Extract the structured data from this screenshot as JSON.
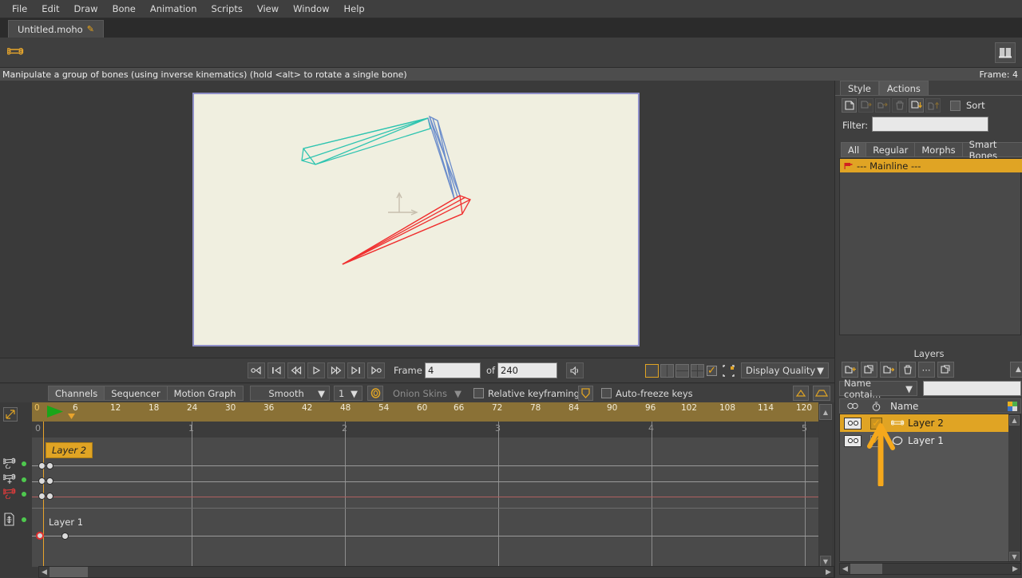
{
  "app": {
    "title": "Moho"
  },
  "menubar": {
    "items": [
      {
        "label": "File"
      },
      {
        "label": "Edit"
      },
      {
        "label": "Draw"
      },
      {
        "label": "Bone"
      },
      {
        "label": "Animation"
      },
      {
        "label": "Scripts"
      },
      {
        "label": "View"
      },
      {
        "label": "Window"
      },
      {
        "label": "Help"
      }
    ]
  },
  "tabbar": {
    "document_tab": "Untitled.moho",
    "modified_marker": "pencil-icon"
  },
  "toolbar": {
    "tool_icon": "bone-manipulate-icon",
    "right_icon": "book-panel-icon"
  },
  "statusbar": {
    "hint": "Manipulate a group of bones (using inverse kinematics) (hold <alt> to rotate a single bone)",
    "frame_label": "Frame: 4"
  },
  "canvas": {
    "background": "#f0efe0",
    "border_color": "#8f8fc8",
    "bones": [
      {
        "name": "upper-bone-teal",
        "color": "#2ec4b0"
      },
      {
        "name": "mid-bone-blue",
        "color": "#6a8ccb"
      },
      {
        "name": "lower-bone-red",
        "color": "#f03030"
      }
    ],
    "origin_gizmo": "move-axis-gizmo"
  },
  "playback": {
    "buttons": [
      {
        "name": "jump-to-start-button",
        "glyph": "o◁"
      },
      {
        "name": "previous-keyframe-button",
        "glyph": "|◁"
      },
      {
        "name": "step-back-button",
        "glyph": "◁◁"
      },
      {
        "name": "play-button",
        "glyph": "▷"
      },
      {
        "name": "step-forward-button",
        "glyph": "▷▷"
      },
      {
        "name": "next-keyframe-button",
        "glyph": "▷|"
      },
      {
        "name": "jump-to-end-button",
        "glyph": "▷o"
      }
    ],
    "frame_label": "Frame",
    "frame_value": "4",
    "of_label": "of",
    "total_frames": "240",
    "audio_button": "speaker-icon",
    "view_buttons": [
      {
        "name": "single-view-button",
        "selected": true
      },
      {
        "name": "split-vertical-view-button",
        "selected": false
      },
      {
        "name": "split-horizontal-view-button",
        "selected": false
      },
      {
        "name": "quad-view-button",
        "selected": false
      }
    ],
    "enable_checkbox": {
      "label": "",
      "checked": true
    },
    "select_tool": "select-bounds-icon",
    "display_quality": "Display Quality"
  },
  "timeline_toolbar": {
    "mode_tabs": [
      {
        "label": "Channels",
        "active": true
      },
      {
        "label": "Sequencer",
        "active": false
      },
      {
        "label": "Motion Graph",
        "active": false
      }
    ],
    "interpolation": "Smooth",
    "interp_value": "1",
    "onion_icon": "onion-skin-toggle-icon",
    "onion_skins": "Onion Skins",
    "relative_keyframing": {
      "label": "Relative keyframing",
      "checked": false
    },
    "shield_icon": "shield-icon",
    "auto_freeze_keys": {
      "label": "Auto-freeze keys",
      "checked": false
    },
    "right_buttons": [
      {
        "name": "ease-in-button"
      },
      {
        "name": "ease-both-button"
      }
    ]
  },
  "timeline": {
    "ruler_ticks": [
      "0",
      "6",
      "12",
      "18",
      "24",
      "30",
      "36",
      "42",
      "48",
      "54",
      "60",
      "66",
      "72",
      "78",
      "84",
      "90",
      "96",
      "102",
      "108",
      "114",
      "120"
    ],
    "second_labels": [
      "0",
      "1",
      "2",
      "3",
      "4",
      "5"
    ],
    "playhead_frame": "4",
    "channels": [
      {
        "name": "bone-rotate-channel",
        "icon": "bone-rotate-icon",
        "enabled": true
      },
      {
        "name": "bone-translate-channel",
        "icon": "bone-translate-icon",
        "enabled": true
      },
      {
        "name": "bone-scale-channel",
        "icon": "bone-scale-icon",
        "enabled": true,
        "highlight": true
      },
      {
        "name": "layer-transform-channel",
        "icon": "layer-transform-icon",
        "enabled": true
      }
    ],
    "group_labels": [
      {
        "text": "Layer 2",
        "style": "chip"
      },
      {
        "text": "Layer 1",
        "style": "plain"
      }
    ],
    "expand_icon": "expand-timeline-icon"
  },
  "actions_panel": {
    "tabs": [
      {
        "label": "Style",
        "active": false
      },
      {
        "label": "Actions",
        "active": true
      }
    ],
    "toolbar_buttons": [
      {
        "name": "new-action-button",
        "enabled": true
      },
      {
        "name": "duplicate-action-button",
        "enabled": false
      },
      {
        "name": "rename-action-button",
        "enabled": false
      },
      {
        "name": "delete-action-button",
        "enabled": false
      },
      {
        "name": "insert-action-button",
        "enabled": true
      },
      {
        "name": "extract-action-button",
        "enabled": false
      }
    ],
    "sort_label": "Sort",
    "sort_checked": false,
    "filter_label": "Filter:",
    "filter_value": "",
    "category_tabs": [
      {
        "label": "All",
        "active": true
      },
      {
        "label": "Regular",
        "active": false
      },
      {
        "label": "Morphs",
        "active": false
      },
      {
        "label": "Smart Bones",
        "active": false
      }
    ],
    "rows": [
      {
        "label": "--- Mainline ---",
        "selected": true,
        "icon": "flag-icon"
      }
    ]
  },
  "layers_panel": {
    "title": "Layers",
    "toolbar_buttons": [
      {
        "name": "new-layer-button"
      },
      {
        "name": "duplicate-layer-button"
      },
      {
        "name": "new-group-button"
      },
      {
        "name": "delete-layer-button"
      },
      {
        "name": "more-options-button"
      },
      {
        "name": "layer-settings-button"
      }
    ],
    "collapse_button": "chevron-up-icon",
    "search_mode": "Name contai...",
    "search_value": "",
    "columns": [
      {
        "name": "visibility-column",
        "icon": "eye-icon"
      },
      {
        "name": "lock-column",
        "icon": "stopwatch-icon"
      },
      {
        "name": "name-column",
        "label": "Name"
      },
      {
        "name": "color-column",
        "icon": "color-swatch-icon"
      }
    ],
    "rows": [
      {
        "name": "Layer 2",
        "icon": "bone-layer-icon",
        "visible": true,
        "checked": true,
        "selected": true
      },
      {
        "name": "Layer 1",
        "icon": "vector-layer-icon",
        "visible": true,
        "checked": true,
        "selected": false
      }
    ],
    "annotation": {
      "name": "highlight-arrow",
      "color": "#f5a81c",
      "points_to": "Layer 2"
    }
  },
  "colors": {
    "accent": "#e0a424",
    "panel_bg": "#3f3f3f",
    "dark_bg": "#3a3a3a",
    "ruler": "#8a7136"
  }
}
